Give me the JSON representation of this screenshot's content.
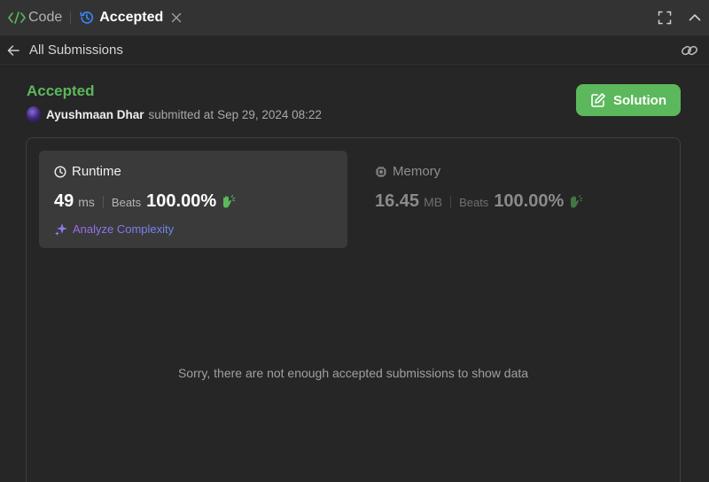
{
  "tabs": {
    "code_label": "Code",
    "accepted_label": "Accepted"
  },
  "subheader": {
    "back_label": "All Submissions"
  },
  "submission": {
    "status": "Accepted",
    "user": "Ayushmaan Dhar",
    "submitted_text": "submitted at",
    "date": "Sep 29, 2024 08:22",
    "solution_label": "Solution"
  },
  "runtime": {
    "title": "Runtime",
    "value": "49",
    "unit": "ms",
    "beats_label": "Beats",
    "beats_value": "100.00%",
    "analyze_label": "Analyze Complexity"
  },
  "memory": {
    "title": "Memory",
    "value": "16.45",
    "unit": "MB",
    "beats_label": "Beats",
    "beats_value": "100.00%"
  },
  "chart": {
    "empty_message": "Sorry, there are not enough accepted submissions to show data"
  },
  "colors": {
    "accent_green": "#5cb85c",
    "tab_bar_bg": "#333333",
    "panel_bg": "#262626",
    "card_bg": "#3a3a3a",
    "history_icon_blue": "#3b82f6"
  },
  "icons": {
    "code": "code-brackets-icon",
    "history": "history-icon",
    "close": "close-icon",
    "maximize": "maximize-icon",
    "collapse": "chevron-up-icon",
    "back": "arrow-left-icon",
    "link": "link-icon",
    "edit": "edit-icon",
    "clock": "clock-icon",
    "chip": "chip-icon",
    "sparkle": "sparkle-icon",
    "clap": "clap-hand-icon"
  }
}
